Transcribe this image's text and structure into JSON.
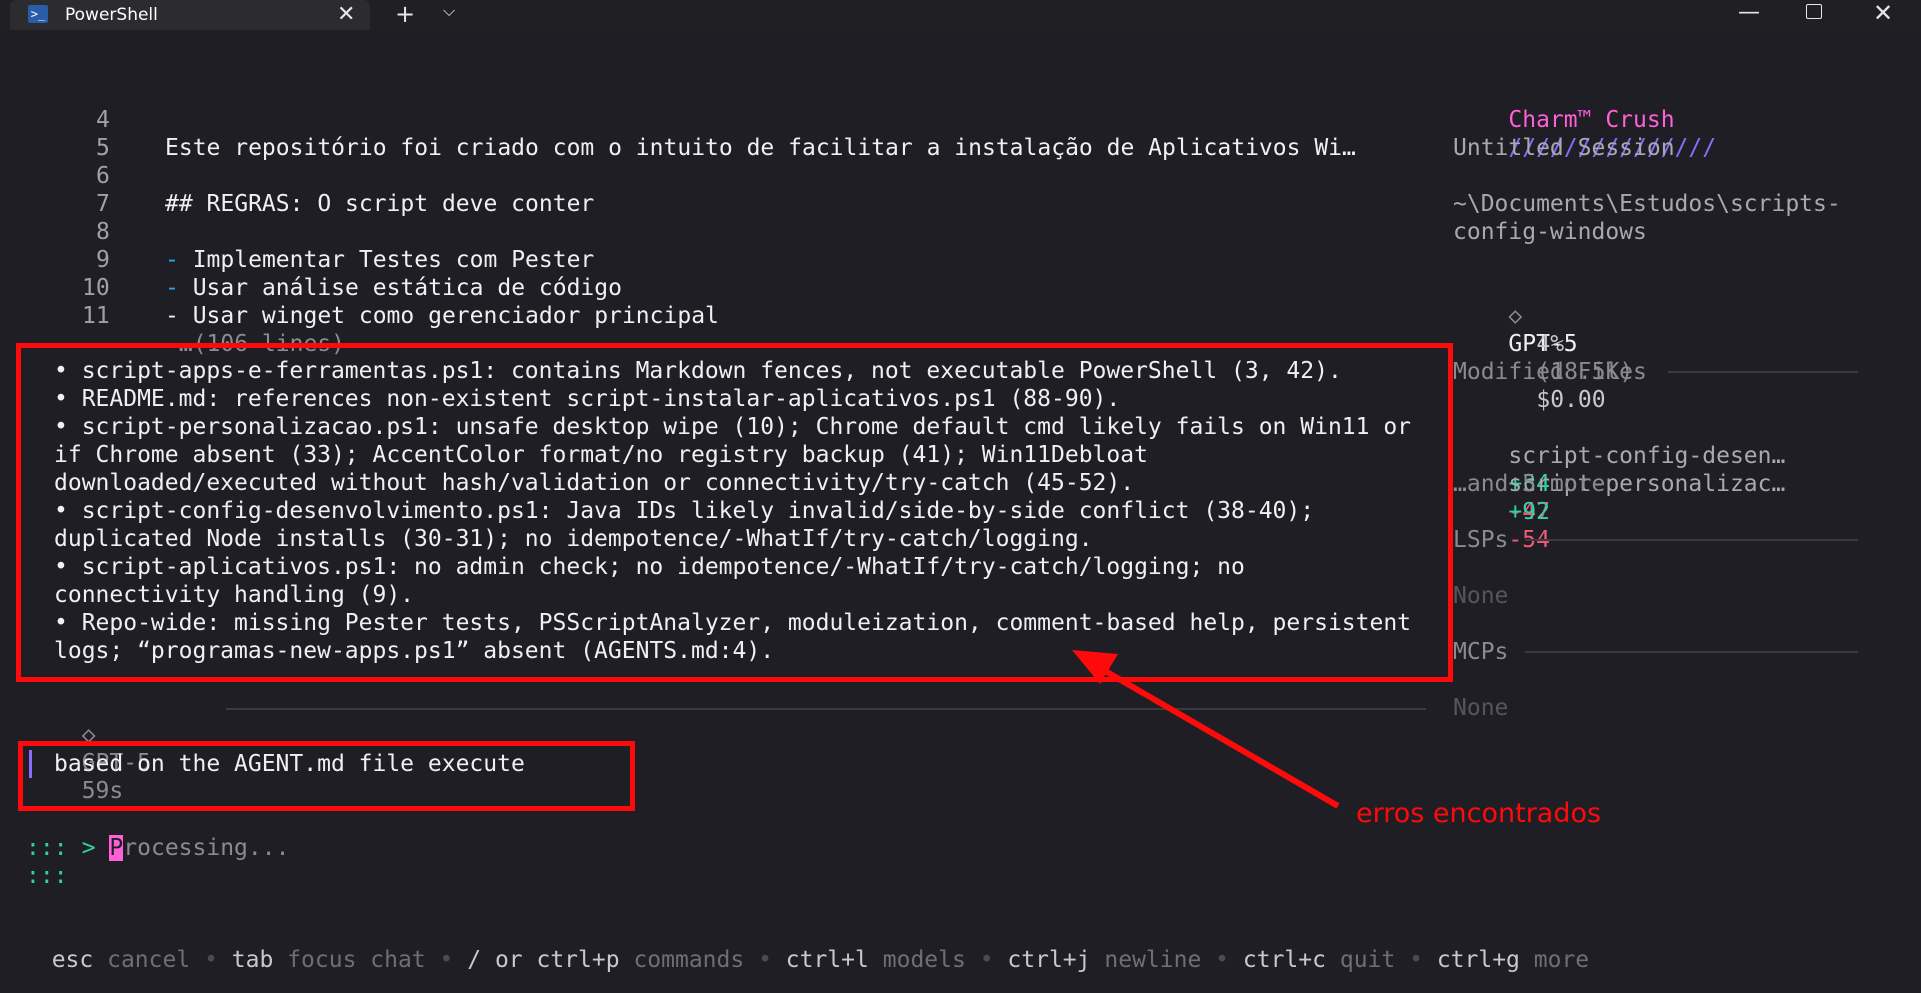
{
  "window": {
    "tab_title": "PowerShell",
    "icons": {
      "tab": "powershell-icon",
      "close_tab": "close-icon",
      "new_tab": "plus-icon",
      "dropdown": "chevron-down-icon",
      "minimize": "minimize-icon",
      "maximize": "maximize-icon",
      "close": "close-icon"
    }
  },
  "file_preview": {
    "lines": [
      {
        "num": "4",
        "text": "Este repositório foi criado com o intuito de facilitar a instalação de Aplicativos Wi…"
      },
      {
        "num": "5",
        "text": ""
      },
      {
        "num": "6",
        "text": "## REGRAS: O script deve conter"
      },
      {
        "num": "7",
        "text": ""
      },
      {
        "num": "8",
        "dash": "-",
        "text": " Implementar Testes com Pester"
      },
      {
        "num": "9",
        "dash": "-",
        "text": " Usar análise estática de código"
      },
      {
        "num": "10",
        "text": "- Usar winget como gerenciador principal"
      },
      {
        "num": "11",
        "text": " …(106 lines)"
      }
    ]
  },
  "findings": [
    "• script-apps-e-ferramentas.ps1: contains Markdown fences, not executable PowerShell (3, 42).",
    "• README.md: references non-existent script-instalar-aplicativos.ps1 (88-90).",
    "• script-personalizacao.ps1: unsafe desktop wipe (10); Chrome default cmd likely fails on Win11 or",
    "if Chrome absent (33); AccentColor format/no registry backup (41); Win11Debloat",
    "downloaded/executed without hash/validation or connectivity/try-catch (45-52).",
    "• script-config-desenvolvimento.ps1: Java IDs likely invalid/side-by-side conflict (38-40);",
    "duplicated Node installs (30-31); no idempotence/-WhatIf/try-catch/logging.",
    "• script-aplicativos.ps1: no admin check; no idempotence/-WhatIf/try-catch/logging; no",
    "connectivity handling (9).",
    "• Repo-wide: missing Pester tests, PSScriptAnalyzer, moduleization, comment-based help, persistent",
    "logs; “programas-new-apps.ps1” absent (AGENTS.md:4)."
  ],
  "message_meta": {
    "diamond": "◇",
    "model": "GPT-5",
    "time": "59s"
  },
  "prompt": {
    "text": "based on the AGENT.md file execute"
  },
  "processing": {
    "caret": ">",
    "cursor": "P",
    "text": "rocessing..."
  },
  "spinner": [
    ":::",
    ":::"
  ],
  "annotation": {
    "label": "erros encontrados",
    "color": "#ff0a0a"
  },
  "sidebar": {
    "brand": "Charm™ Crush",
    "brand_slashes": "///////////////",
    "session_title": "Untitled Session",
    "path_line1": "~\\Documents\\Estudos\\scripts-",
    "path_line2": "config-windows",
    "model_diamond": "◇",
    "model": "GPT-5",
    "usage_pct": "4%",
    "usage_tokens": "(18.5K)",
    "usage_cost": "$0.00",
    "modified_heading": "Modified Files",
    "modified_files": [
      {
        "name": "script-config-desen…",
        "added": "+34",
        "removed": "-47"
      },
      {
        "name": "script-personalizac…",
        "added": "+92",
        "removed": "-54"
      }
    ],
    "more": "…and 5 more",
    "lsps_heading": "LSPs",
    "lsps_value": "None",
    "mcps_heading": "MCPs",
    "mcps_value": "None"
  },
  "help_bar": [
    {
      "key": "esc",
      "desc": "cancel"
    },
    {
      "key": "tab",
      "desc": "focus chat"
    },
    {
      "key": "/ or ctrl+p",
      "desc": "commands"
    },
    {
      "key": "ctrl+l",
      "desc": "models"
    },
    {
      "key": "ctrl+j",
      "desc": "newline"
    },
    {
      "key": "ctrl+c",
      "desc": "quit"
    },
    {
      "key": "ctrl+g",
      "desc": "more"
    }
  ],
  "help_separator": "•",
  "colors": {
    "background": "#1e1e24",
    "accent_pink": "#ff5fd7",
    "accent_purple": "#8b6bff",
    "added_green": "#2fd3a3",
    "removed_red": "#f25a74",
    "annotation_red": "#ff0a0a"
  }
}
